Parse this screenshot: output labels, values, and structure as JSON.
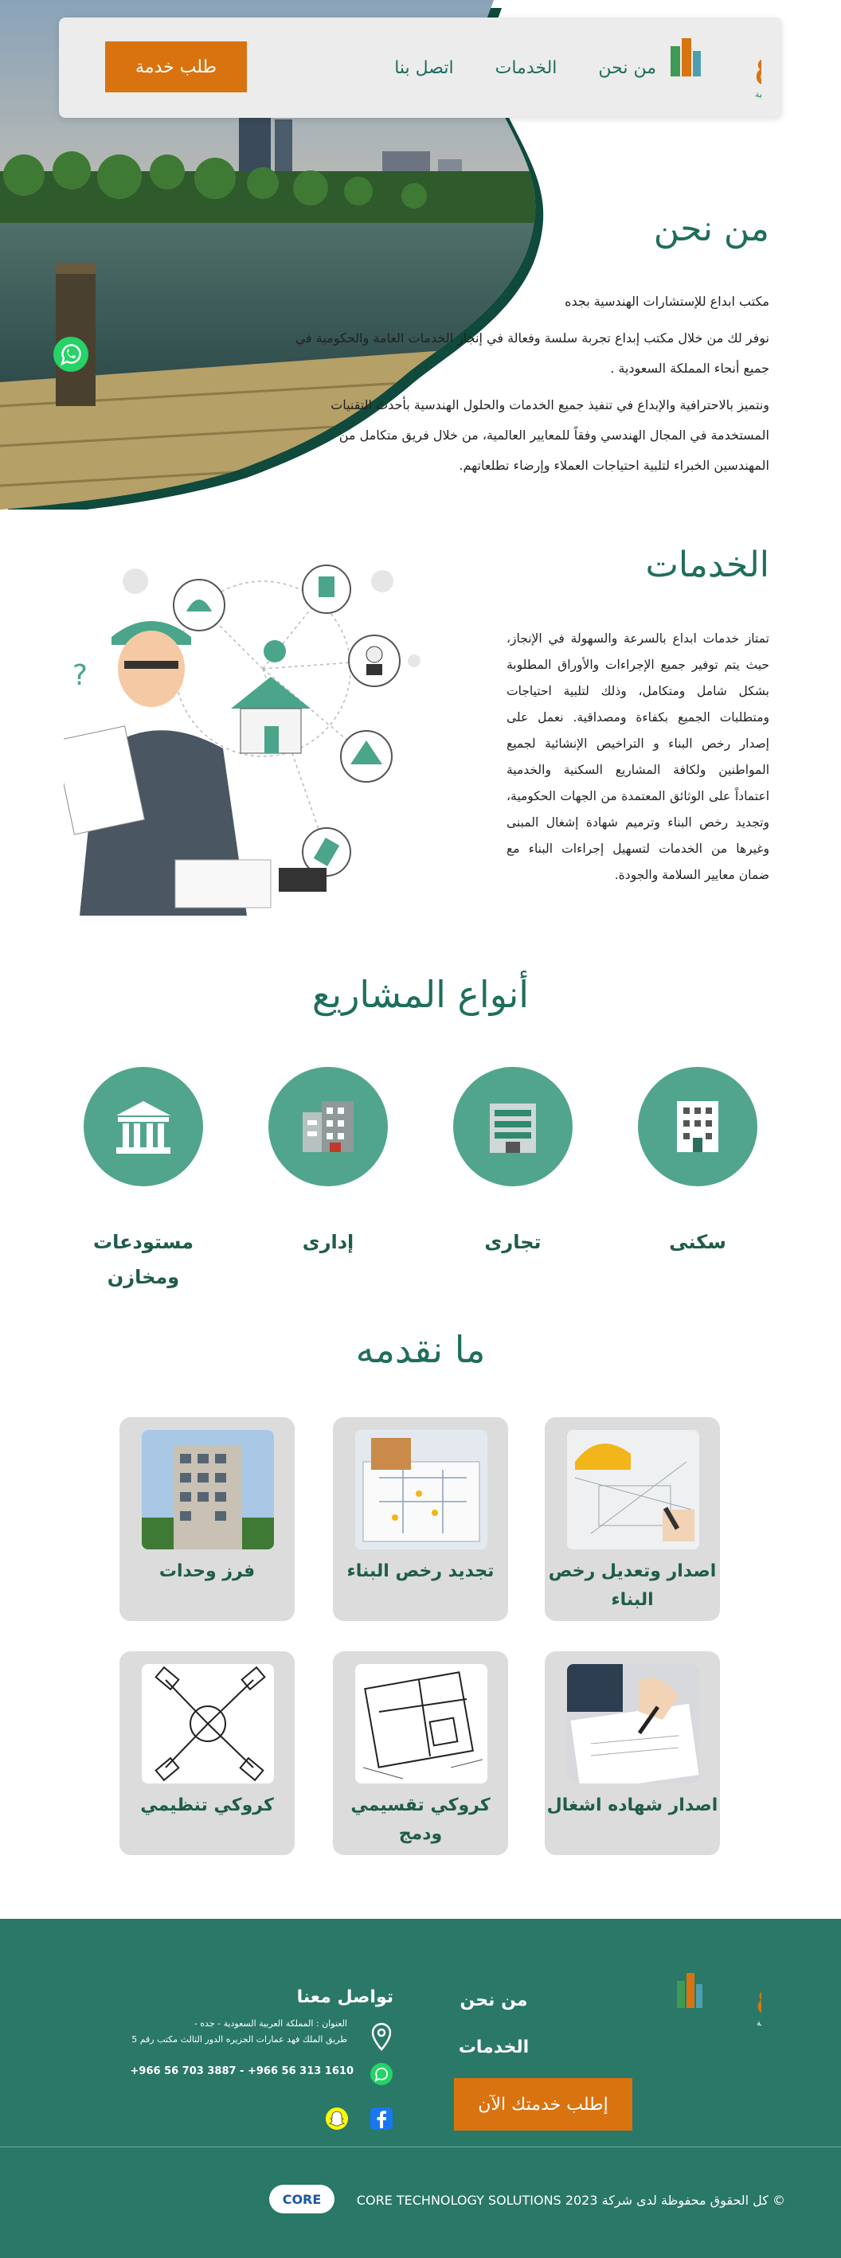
{
  "brand": {
    "logo_text": "إبداع",
    "logo_subtext": "للإستشارات الهندسية"
  },
  "nav": {
    "links": [
      "من نحن",
      "الخدمات",
      "اتصل بنا"
    ],
    "cta": "طلب خدمة"
  },
  "about": {
    "title": "من نحن",
    "paragraphs": [
      "مكتب ابداع للإستشارات الهندسية بجده",
      "نوفر لك من خلال مكتب إبداع تجربة سلسة وفعالة في إنجاز الخدمات العامة والحكومية في جميع أنحاء المملكة السعودية .",
      "ونتميز بالاحترافية والإبداع في تنفيذ جميع الخدمات والحلول الهندسية بأحدث التقنيات المستخدمة في المجال الهندسي وفقاً للمعايير العالمية، من خلال فريق متكامل من المهندسين الخبراء لتلبية احتياجات العملاء وإرضاء تطلعاتهم."
    ]
  },
  "services": {
    "title": "الخدمات",
    "text": "تمتاز خدمات ابداع بالسرعة والسهولة في الإنجاز، حيث يتم توفير جميع الإجراءات والأوراق المطلوبة بشكل شامل ومتكامل، وذلك لتلبية احتياجات ومتطلبات الجميع بكفاءة ومصداقية. نعمل على إصدار رخص البناء و التراخيص الإنشائية لجميع المواطنين ولكافة المشاريع السكنية والخدمية اعتماداً على الوثائق المعتمدة من الجهات الحكومية، وتجديد رخص البناء وترميم شهادة إشغال المبنى وغيرها من الخدمات لتسهيل إجراءات البناء مع ضمان معايير السلامة والجودة."
  },
  "project_types": {
    "title": "أنواع المشاريع",
    "items": [
      {
        "label": "سكنى",
        "icon": "residential-building-icon"
      },
      {
        "label": "تجارى",
        "icon": "commercial-building-icon"
      },
      {
        "label": "إدارى",
        "icon": "office-building-icon"
      },
      {
        "label": "مستودعات ومخازن",
        "icon": "warehouse-icon"
      }
    ]
  },
  "offerings": {
    "title": "ما نقدمه",
    "items": [
      {
        "label": "اصدار وتعديل رخص البناء",
        "image": "architect-blueprint-image"
      },
      {
        "label": "تجديد رخص البناء",
        "image": "construction-plan-image"
      },
      {
        "label": "فرز وحدات",
        "image": "apartment-building-image"
      },
      {
        "label": "اصدار شهاده اشغال",
        "image": "signing-document-image"
      },
      {
        "label": "كروكي تقسيمي ودمج",
        "image": "floor-plan-sketch-image"
      },
      {
        "label": "كروكي تنظيمي",
        "image": "tools-sketch-image"
      }
    ]
  },
  "footer": {
    "links": [
      "من نحن",
      "الخدمات"
    ],
    "cta": "إطلب خدمتك الآن",
    "contact_title": "تواصل معنا",
    "address_line1": "العنوان : المملكة العربية السعودية - جده -",
    "address_line2": "طريق الملك فهد عمارات الجزيره الدور الثالث مكتب رقم 5",
    "phones": "+966 56 703 3887   -   +966 56 313 1610",
    "copyright": "© كل الحقوق محفوظة لدى شركة 2023  CORE TECHNOLOGY SOLUTIONS",
    "core_badge": "CORE"
  },
  "colors": {
    "brand_green": "#1f6e5c",
    "accent_orange": "#d97310",
    "footer_bg": "#2a7868",
    "circle_green": "#52a58d"
  }
}
